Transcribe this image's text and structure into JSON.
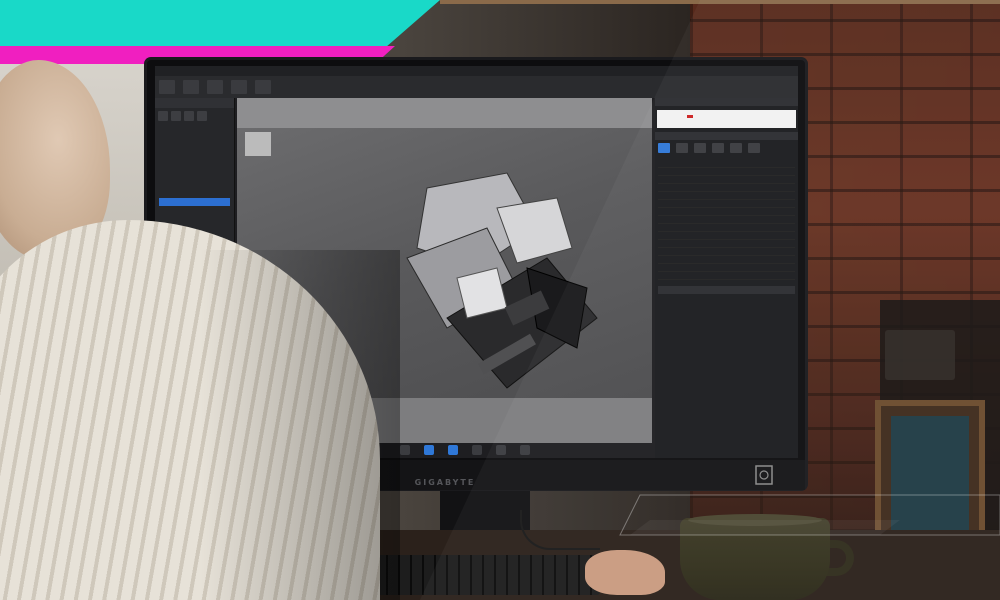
{
  "monitor": {
    "brand": "GIGABYTE"
  },
  "app": {
    "dock": [
      {
        "icon": "home-icon",
        "label": ""
      },
      {
        "icon": "cube-icon",
        "label": "",
        "active": true
      },
      {
        "icon": "layers-icon",
        "label": "",
        "active": true
      },
      {
        "icon": "camera-icon",
        "label": ""
      },
      {
        "icon": "light-icon",
        "label": ""
      },
      {
        "icon": "render-icon",
        "label": ""
      }
    ]
  },
  "colors": {
    "banner_cyan": "#19d9c8",
    "banner_magenta": "#f01fc0",
    "selection_blue": "#2c6fd1"
  }
}
